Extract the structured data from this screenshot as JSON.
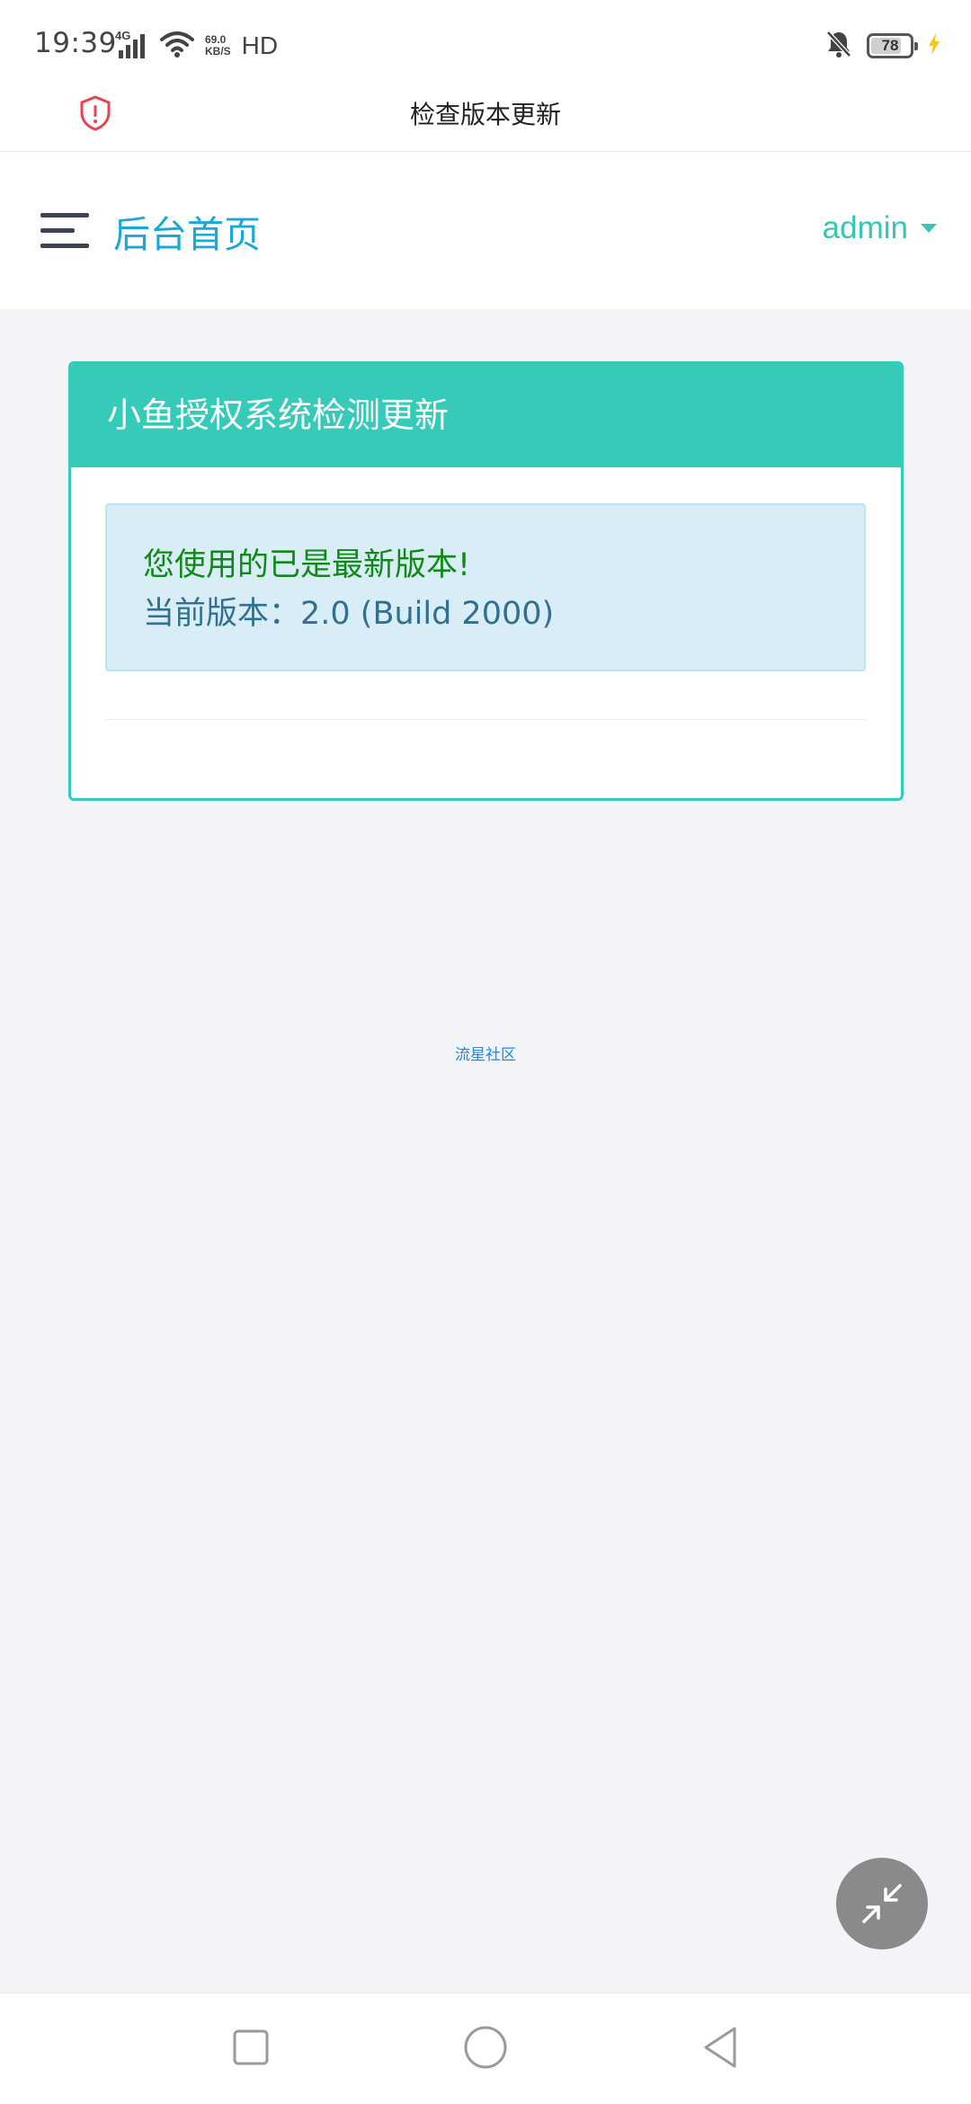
{
  "status_bar": {
    "time": "19:39",
    "network": "4G",
    "speed_value": "69.0",
    "speed_unit": "KB/S",
    "hd_label": "HD",
    "battery_level": "78",
    "battery_fraction": 0.78
  },
  "titlebar": {
    "title": "检查版本更新"
  },
  "header": {
    "home_label": "后台首页",
    "user_label": "admin"
  },
  "panel": {
    "heading": "小鱼授权系统检测更新",
    "status_message": "您使用的已是最新版本!",
    "version_text": "当前版本：2.0 (Build 2000)"
  },
  "footer": {
    "link_text": "流星社区"
  },
  "colors": {
    "accent": "#36cab9",
    "link": "#1aa9d6",
    "success_text": "#0f8a16",
    "info_text": "#31708f",
    "alert_bg": "#d9edf6",
    "page_bg": "#f2f4f8"
  },
  "icons": {
    "shield": "shield-alert-icon",
    "menu": "hamburger-menu-icon",
    "fab": "minimize-arrows-icon",
    "nav_recent": "square-icon",
    "nav_home": "circle-icon",
    "nav_back": "triangle-back-icon"
  }
}
